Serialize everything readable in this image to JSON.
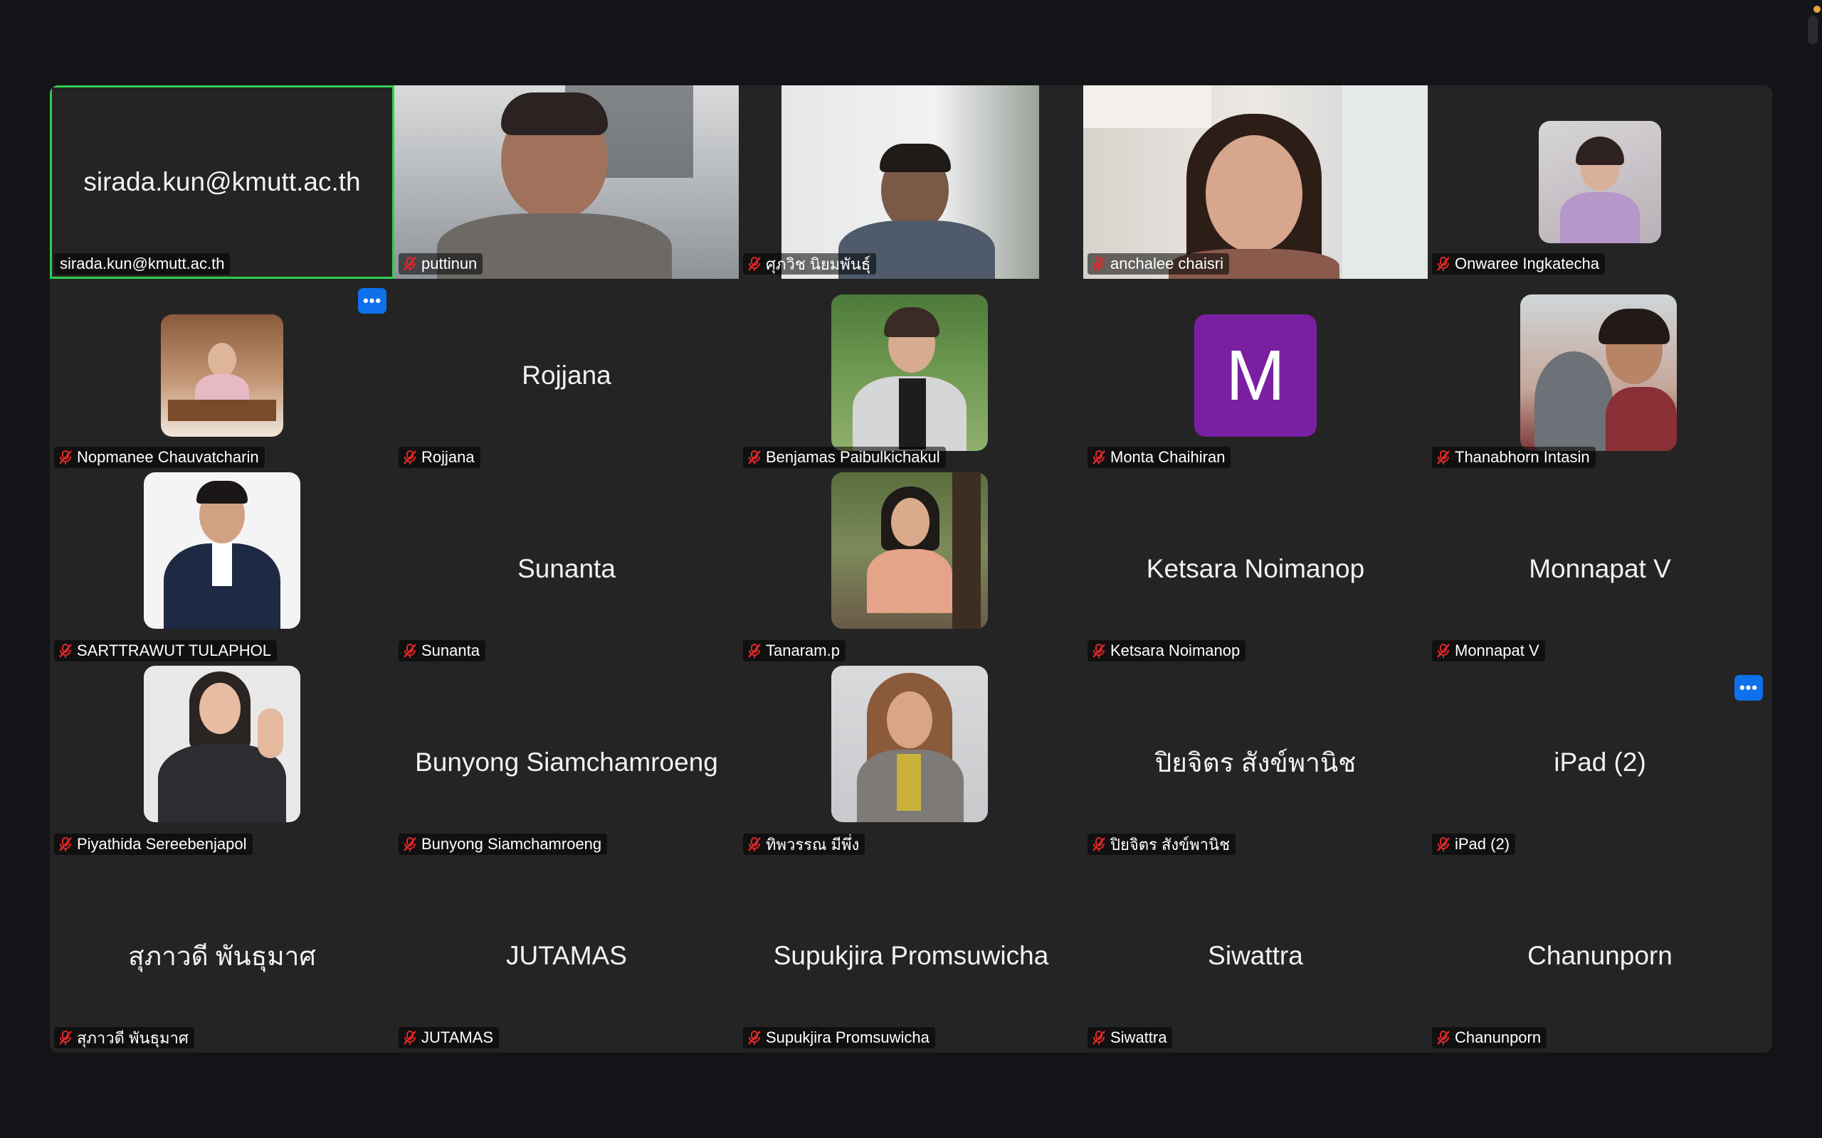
{
  "window": {
    "title": "Zoom Meeting gallery view"
  },
  "tiles": [
    {
      "name": "sirada.kun@kmutt.ac.th",
      "center": "sirada.kun@kmutt.ac.th",
      "muted": false,
      "active": true
    },
    {
      "name": "puttinun",
      "center": "",
      "muted": true
    },
    {
      "name": "ศุภวิช นิยมพันธุ์",
      "center": "",
      "muted": true
    },
    {
      "name": "anchalee chaisri",
      "center": "",
      "muted": true
    },
    {
      "name": "Onwaree Ingkatecha",
      "center": "",
      "muted": true
    },
    {
      "name": "Nopmanee Chauvatcharin",
      "center": "",
      "muted": true
    },
    {
      "name": "Rojjana",
      "center": "Rojjana",
      "muted": true
    },
    {
      "name": "Benjamas Paibulkichakul",
      "center": "",
      "muted": true
    },
    {
      "name": "Monta Chaihiran",
      "center": "",
      "avatar_letter": "M",
      "muted": true
    },
    {
      "name": "Thanabhorn Intasin",
      "center": "",
      "muted": true
    },
    {
      "name": "SARTTRAWUT TULAPHOL",
      "center": "",
      "muted": true
    },
    {
      "name": "Sunanta",
      "center": "Sunanta",
      "muted": true
    },
    {
      "name": "Tanaram.p",
      "center": "",
      "muted": true
    },
    {
      "name": "Ketsara Noimanop",
      "center": "Ketsara Noimanop",
      "muted": true
    },
    {
      "name": "Monnapat V",
      "center": "Monnapat V",
      "muted": true
    },
    {
      "name": "Piyathida Sereebenjapol",
      "center": "",
      "muted": true
    },
    {
      "name": "Bunyong Siamchamroeng",
      "center": "Bunyong Siamchamroeng",
      "muted": true
    },
    {
      "name": "ทิพวรรณ มีพึ่ง",
      "center": "",
      "muted": true
    },
    {
      "name": "ปิยจิตร สังข์พานิช",
      "center": "ปิยจิตร สังข์พานิช",
      "muted": true
    },
    {
      "name": "iPad (2)",
      "center": "iPad (2)",
      "muted": true
    },
    {
      "name": "สุภาวดี พันธุมาศ",
      "center": "สุภาวดี พันธุมาศ",
      "muted": true
    },
    {
      "name": "JUTAMAS",
      "center": "JUTAMAS",
      "muted": true
    },
    {
      "name": "Supukjira Promsuwicha",
      "center": "Supukjira Promsuwicha",
      "muted": true
    },
    {
      "name": "Siwattra",
      "center": "Siwattra",
      "muted": true
    },
    {
      "name": "Chanunporn",
      "center": "Chanunporn",
      "muted": true
    }
  ],
  "more_button_label": "•••",
  "colors": {
    "active_speaker_border": "#2fcf4f",
    "more_button": "#0e71eb",
    "muted_icon": "#e02828",
    "avatar_m": "#7b1fa2",
    "tile_bg": "#242424"
  }
}
